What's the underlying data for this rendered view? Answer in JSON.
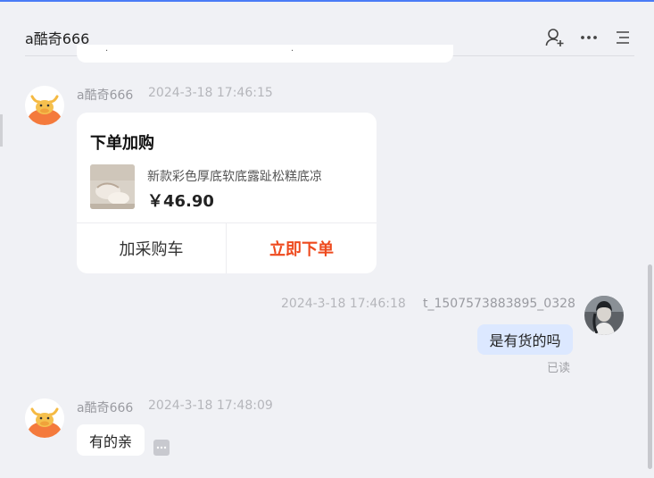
{
  "header": {
    "title": "a酷奇666",
    "icons": [
      "user-add-icon",
      "more-icon",
      "menu-icon"
    ]
  },
  "messages": [
    {
      "sender": "a酷奇666",
      "time": "2024-3-18 17:46:15",
      "type": "order_card",
      "card": {
        "title": "下单加购",
        "product_name": "新款彩色厚底软底露趾松糕底凉",
        "price": "￥46.90",
        "add_to_cart_label": "加采购车",
        "buy_now_label": "立即下单"
      }
    },
    {
      "sender": "t_1507573883895_0328",
      "time": "2024-3-18 17:46:18",
      "type": "text",
      "text": "是有货的吗",
      "status": "已读"
    },
    {
      "sender": "a酷奇666",
      "time": "2024-3-18 17:48:09",
      "type": "text",
      "text": "有的亲"
    }
  ],
  "colors": {
    "accent_top": "#4a7cf6",
    "buy_button": "#ee4a1e",
    "self_bubble": "#dce8ff",
    "background": "#f0f1f5"
  }
}
